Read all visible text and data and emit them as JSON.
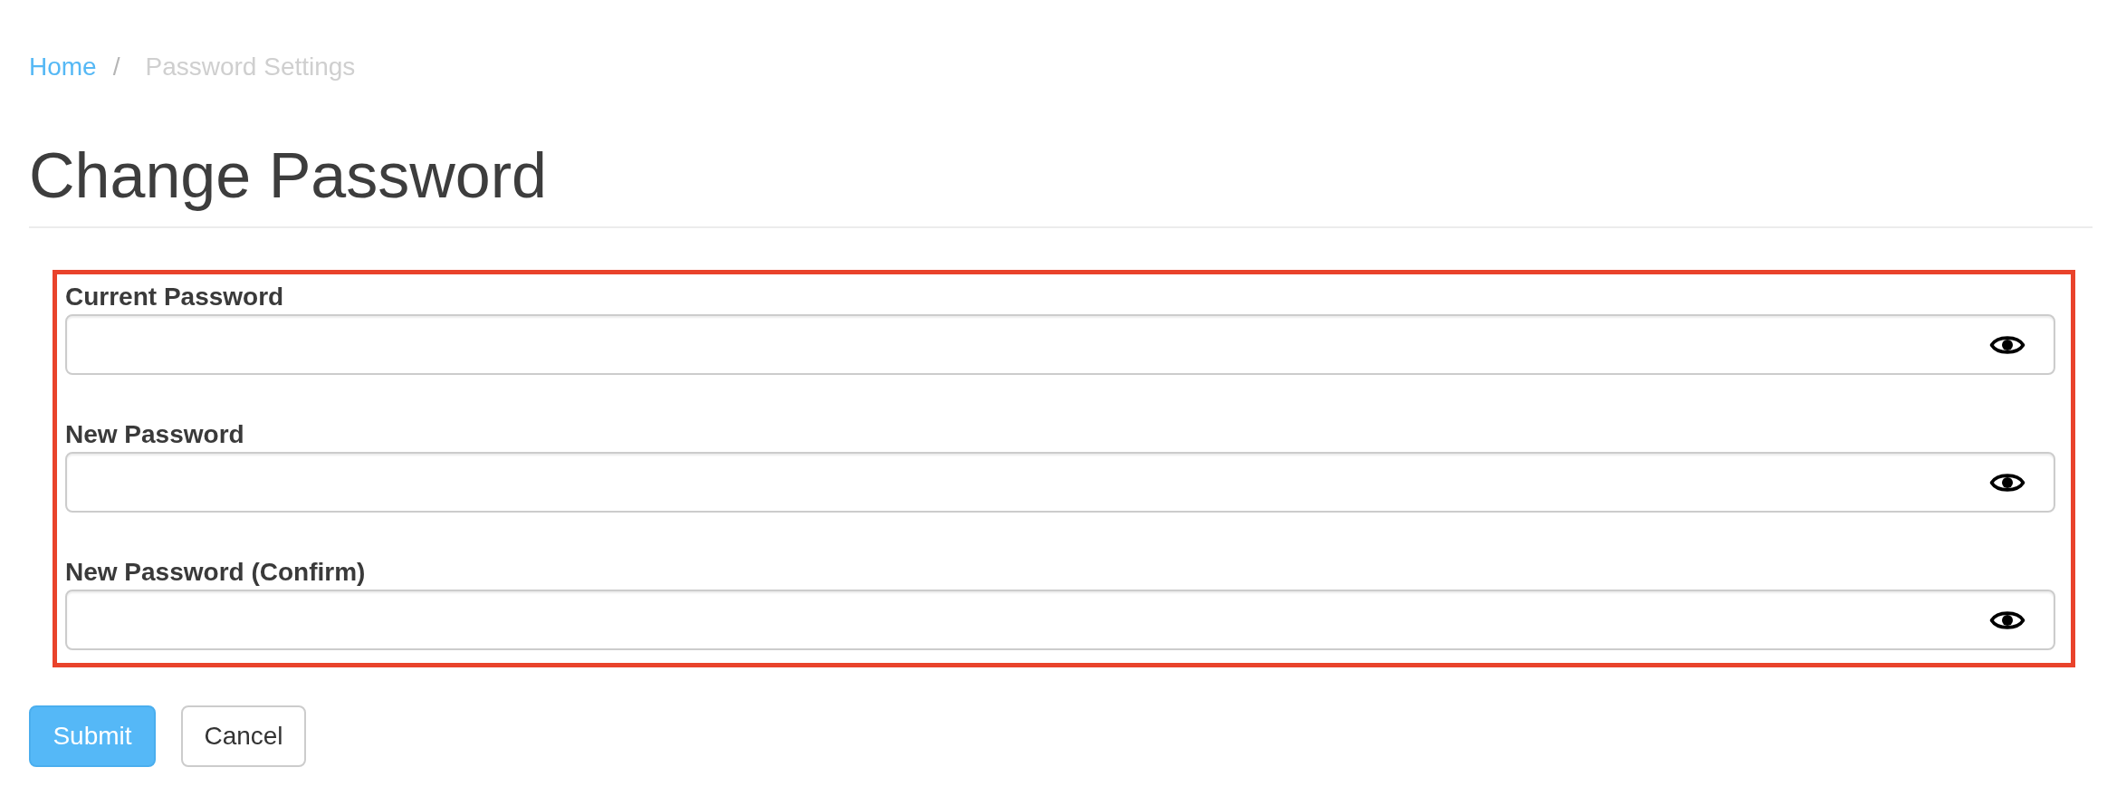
{
  "breadcrumb": {
    "items": [
      {
        "label": "Home",
        "kind": "link"
      },
      {
        "label": "Password Settings",
        "kind": "current"
      }
    ],
    "separator": "/"
  },
  "title": "Change Password",
  "form": {
    "highlighted": true,
    "fields": [
      {
        "label": "Current Password"
      },
      {
        "label": "New Password"
      },
      {
        "label": "New Password (Confirm)"
      }
    ]
  },
  "buttons": [
    {
      "label": "Submit",
      "kind": "submit"
    },
    {
      "label": "Cancel",
      "kind": "cancel"
    }
  ]
}
